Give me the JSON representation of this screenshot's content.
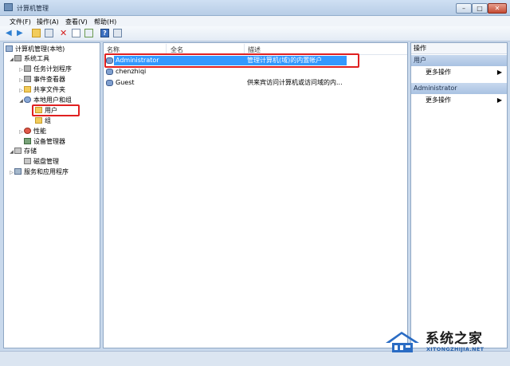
{
  "window": {
    "title": "计算机管理"
  },
  "menu": [
    "文件(F)",
    "操作(A)",
    "查看(V)",
    "帮助(H)"
  ],
  "tree": {
    "root": "计算机管理(本地)",
    "system_tools": "系统工具",
    "task_scheduler": "任务计划程序",
    "event_viewer": "事件查看器",
    "shared_folders": "共享文件夹",
    "local_users_groups": "本地用户和组",
    "users": "用户",
    "groups": "组",
    "performance": "性能",
    "device_manager": "设备管理器",
    "storage": "存储",
    "disk_management": "磁盘管理",
    "services_apps": "服务和应用程序"
  },
  "list": {
    "columns": [
      "名称",
      "全名",
      "描述"
    ],
    "rows": [
      {
        "name": "Administrator",
        "fullname": "",
        "desc": "管理计算机(域)的内置帐户"
      },
      {
        "name": "chenzhiqi",
        "fullname": "",
        "desc": ""
      },
      {
        "name": "Guest",
        "fullname": "",
        "desc": "供来宾访问计算机或访问域的内..."
      }
    ]
  },
  "actions": {
    "header": "操作",
    "section1": {
      "title": "用户",
      "more": "更多操作"
    },
    "section2": {
      "title": "Administrator",
      "more": "更多操作"
    }
  },
  "watermark": {
    "name": "系统之家",
    "url": "XITONGZHIJIA.NET"
  },
  "colors": {
    "selection": "#3399ff",
    "highlight_box": "#e02020"
  }
}
